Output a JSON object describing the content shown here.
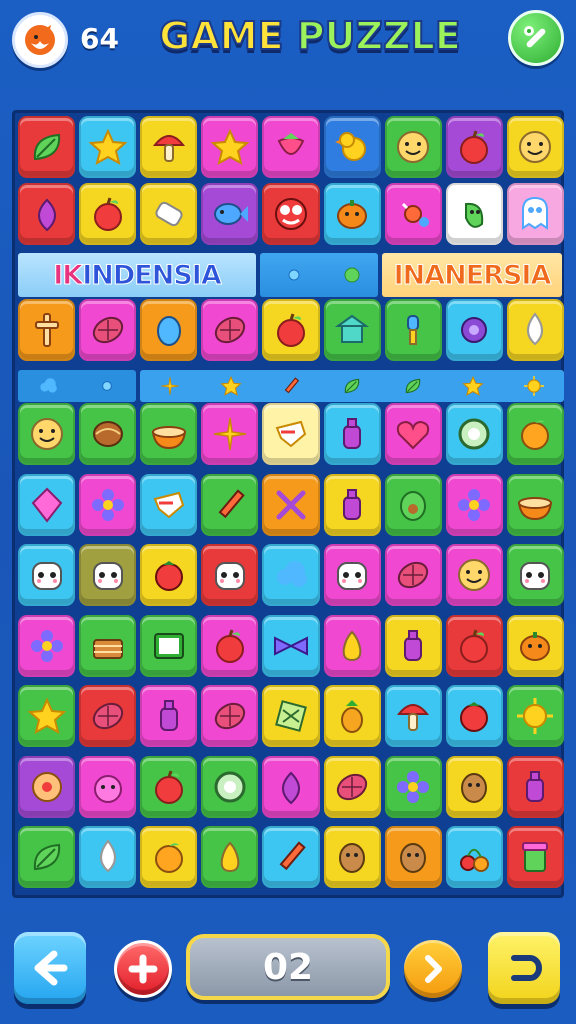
{
  "header": {
    "score": "64",
    "title_part1": "GAME ",
    "title_part2": "PUZZLE",
    "title_part3": "ZLE",
    "avatar_icon": "orange-fox-icon",
    "tools_icon": "wrench-icon"
  },
  "banners": {
    "left_k": "IK",
    "left_text": "INDENSIA",
    "right_text": "INANERSIA"
  },
  "board": {
    "rows_top": [
      [
        {
          "c": "#e83a3a",
          "i": "leaf"
        },
        {
          "c": "#3ec6f2",
          "i": "star"
        },
        {
          "c": "#f5d621",
          "i": "mushroom"
        },
        {
          "c": "#f048d0",
          "i": "star"
        },
        {
          "c": "#f048d0",
          "i": "strawberry"
        },
        {
          "c": "#2f7de0",
          "i": "duck"
        },
        {
          "c": "#45c448",
          "i": "face"
        },
        {
          "c": "#a54ad6",
          "i": "apple"
        },
        {
          "c": "#f5d621",
          "i": "face"
        }
      ],
      [
        {
          "c": "#e83a3a",
          "i": "onion"
        },
        {
          "c": "#f5d621",
          "i": "apple"
        },
        {
          "c": "#f5d621",
          "i": "tag"
        },
        {
          "c": "#a54ad6",
          "i": "fish"
        },
        {
          "c": "#e83a3a",
          "i": "monster"
        },
        {
          "c": "#3ec6f2",
          "i": "pumpkin"
        },
        {
          "c": "#f048d0",
          "i": "candy"
        },
        {
          "c": "#ffffff",
          "i": "pepper"
        },
        {
          "c": "#f7a8e0",
          "i": "ghost"
        }
      ],
      [
        {
          "c": "#f59a1a",
          "i": "cross"
        },
        {
          "c": "#f048d0",
          "i": "melon"
        },
        {
          "c": "#f59a1a",
          "i": "egg"
        },
        {
          "c": "#f048d0",
          "i": "melon"
        },
        {
          "c": "#f5d621",
          "i": "apple"
        },
        {
          "c": "#45c448",
          "i": "temple"
        },
        {
          "c": "#45c448",
          "i": "lamp"
        },
        {
          "c": "#3ec6f2",
          "i": "gear"
        },
        {
          "c": "#f5d621",
          "i": "drop"
        }
      ]
    ],
    "rows_bottom": [
      [
        {
          "c": "#45c448",
          "i": "face"
        },
        {
          "c": "#45c448",
          "i": "coconut"
        },
        {
          "c": "#45c448",
          "i": "bowl"
        },
        {
          "c": "#f048d0",
          "i": "spark"
        },
        {
          "c": "#fff3a8",
          "i": "bird"
        },
        {
          "c": "#3ec6f2",
          "i": "bottle"
        },
        {
          "c": "#f048d0",
          "i": "heart"
        },
        {
          "c": "#3ec6f2",
          "i": "kiwi"
        },
        {
          "c": "#45c448",
          "i": "orange"
        }
      ],
      [
        {
          "c": "#3ec6f2",
          "i": "gem"
        },
        {
          "c": "#f048d0",
          "i": "flower"
        },
        {
          "c": "#3ec6f2",
          "i": "bird"
        },
        {
          "c": "#45c448",
          "i": "pencil"
        },
        {
          "c": "#f59a1a",
          "i": "scissors"
        },
        {
          "c": "#f5d621",
          "i": "bottle"
        },
        {
          "c": "#45c448",
          "i": "avocado"
        },
        {
          "c": "#f048d0",
          "i": "flower"
        },
        {
          "c": "#45c448",
          "i": "bowl"
        }
      ],
      [
        {
          "c": "#3ec6f2",
          "i": "panda"
        },
        {
          "c": "#a0a040",
          "i": "panda"
        },
        {
          "c": "#f5d621",
          "i": "tomato"
        },
        {
          "c": "#e83a3a",
          "i": "panda"
        },
        {
          "c": "#3ec6f2",
          "i": "cloud"
        },
        {
          "c": "#f048d0",
          "i": "panda"
        },
        {
          "c": "#f048d0",
          "i": "melon"
        },
        {
          "c": "#f048d0",
          "i": "face"
        },
        {
          "c": "#45c448",
          "i": "panda"
        }
      ],
      [
        {
          "c": "#f048d0",
          "i": "flower"
        },
        {
          "c": "#45c448",
          "i": "cake"
        },
        {
          "c": "#45c448",
          "i": "book"
        },
        {
          "c": "#f048d0",
          "i": "apple"
        },
        {
          "c": "#3ec6f2",
          "i": "bow"
        },
        {
          "c": "#f048d0",
          "i": "pear"
        },
        {
          "c": "#f5d621",
          "i": "bottle"
        },
        {
          "c": "#e83a3a",
          "i": "apple"
        },
        {
          "c": "#f5d621",
          "i": "pumpkin"
        }
      ],
      [
        {
          "c": "#45c448",
          "i": "star"
        },
        {
          "c": "#e83a3a",
          "i": "melon"
        },
        {
          "c": "#f048d0",
          "i": "bottle"
        },
        {
          "c": "#f048d0",
          "i": "melon"
        },
        {
          "c": "#f5d621",
          "i": "net"
        },
        {
          "c": "#f5d621",
          "i": "pineapple"
        },
        {
          "c": "#3ec6f2",
          "i": "mushroom"
        },
        {
          "c": "#3ec6f2",
          "i": "tomato"
        },
        {
          "c": "#45c448",
          "i": "sun"
        }
      ],
      [
        {
          "c": "#a54ad6",
          "i": "donut"
        },
        {
          "c": "#f048d0",
          "i": "blob"
        },
        {
          "c": "#45c448",
          "i": "apple"
        },
        {
          "c": "#45c448",
          "i": "kiwi"
        },
        {
          "c": "#f048d0",
          "i": "onion"
        },
        {
          "c": "#f5d621",
          "i": "melon"
        },
        {
          "c": "#45c448",
          "i": "flower"
        },
        {
          "c": "#f5d621",
          "i": "potato"
        },
        {
          "c": "#e83a3a",
          "i": "bottle"
        }
      ],
      [
        {
          "c": "#45c448",
          "i": "leaf"
        },
        {
          "c": "#3ec6f2",
          "i": "drop"
        },
        {
          "c": "#f5d621",
          "i": "orange"
        },
        {
          "c": "#45c448",
          "i": "pear"
        },
        {
          "c": "#3ec6f2",
          "i": "pencil"
        },
        {
          "c": "#f5d621",
          "i": "potato"
        },
        {
          "c": "#f59a1a",
          "i": "potato"
        },
        {
          "c": "#3ec6f2",
          "i": "cherry"
        },
        {
          "c": "#e83a3a",
          "i": "cup"
        }
      ]
    ]
  },
  "controls": {
    "level": "02",
    "back_icon": "arrow-left-icon",
    "add_icon": "plus-icon",
    "next_icon": "chevron-right-icon",
    "undo_icon": "return-icon"
  }
}
